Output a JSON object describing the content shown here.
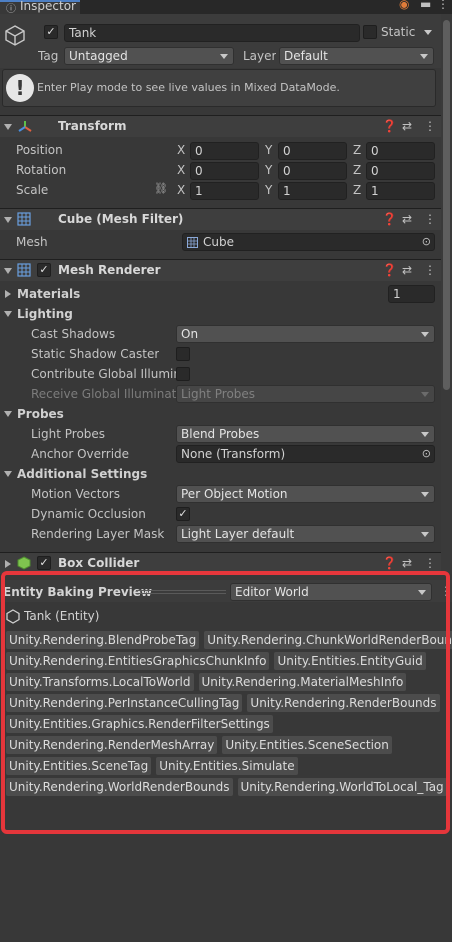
{
  "tab": {
    "label": "Inspector"
  },
  "gameobject": {
    "name": "Tank",
    "static_label": "Static",
    "tag_label": "Tag",
    "tag_value": "Untagged",
    "layer_label": "Layer",
    "layer_value": "Default"
  },
  "info": {
    "message": "Enter Play mode to see live values in Mixed DataMode."
  },
  "transform": {
    "title": "Transform",
    "position_label": "Position",
    "rotation_label": "Rotation",
    "scale_label": "Scale",
    "x": "X",
    "y": "Y",
    "z": "Z",
    "position": [
      "0",
      "0",
      "0"
    ],
    "rotation": [
      "0",
      "0",
      "0"
    ],
    "scale": [
      "1",
      "1",
      "1"
    ]
  },
  "mesh_filter": {
    "title": "Cube (Mesh Filter)",
    "mesh_label": "Mesh",
    "mesh_value": "Cube"
  },
  "mesh_renderer": {
    "title": "Mesh Renderer",
    "materials_label": "Materials",
    "materials_count": "1",
    "lighting_label": "Lighting",
    "cast_shadows_label": "Cast Shadows",
    "cast_shadows_value": "On",
    "static_shadow_label": "Static Shadow Caster",
    "contribute_gi_label": "Contribute Global Illumina",
    "receive_gi_label": "Receive Global Illuminatic",
    "receive_gi_value": "Light Probes",
    "probes_label": "Probes",
    "light_probes_label": "Light Probes",
    "light_probes_value": "Blend Probes",
    "anchor_label": "Anchor Override",
    "anchor_value": "None (Transform)",
    "additional_label": "Additional Settings",
    "motion_vectors_label": "Motion Vectors",
    "motion_vectors_value": "Per Object Motion",
    "dynamic_occlusion_label": "Dynamic Occlusion",
    "rendering_layer_label": "Rendering Layer Mask",
    "rendering_layer_value": "Light Layer default"
  },
  "box_collider": {
    "title": "Box Collider"
  },
  "baking": {
    "title": "Entity Baking Preview",
    "world_value": "Editor World",
    "entity_label": "Tank (Entity)",
    "components": [
      "Unity.Rendering.BlendProbeTag",
      "Unity.Rendering.ChunkWorldRenderBounds",
      "Unity.Rendering.EntitiesGraphicsChunkInfo",
      "Unity.Entities.EntityGuid",
      "Unity.Transforms.LocalToWorld",
      "Unity.Rendering.MaterialMeshInfo",
      "Unity.Rendering.PerInstanceCullingTag",
      "Unity.Rendering.RenderBounds",
      "Unity.Entities.Graphics.RenderFilterSettings",
      "Unity.Rendering.RenderMeshArray",
      "Unity.Entities.SceneSection",
      "Unity.Entities.SceneTag",
      "Unity.Entities.Simulate",
      "Unity.Rendering.WorldRenderBounds",
      "Unity.Rendering.WorldToLocal_Tag"
    ]
  },
  "colors": {
    "highlight_border": "#e5363b",
    "panel_bg": "#383838",
    "header_bg": "#3e3e3e"
  }
}
